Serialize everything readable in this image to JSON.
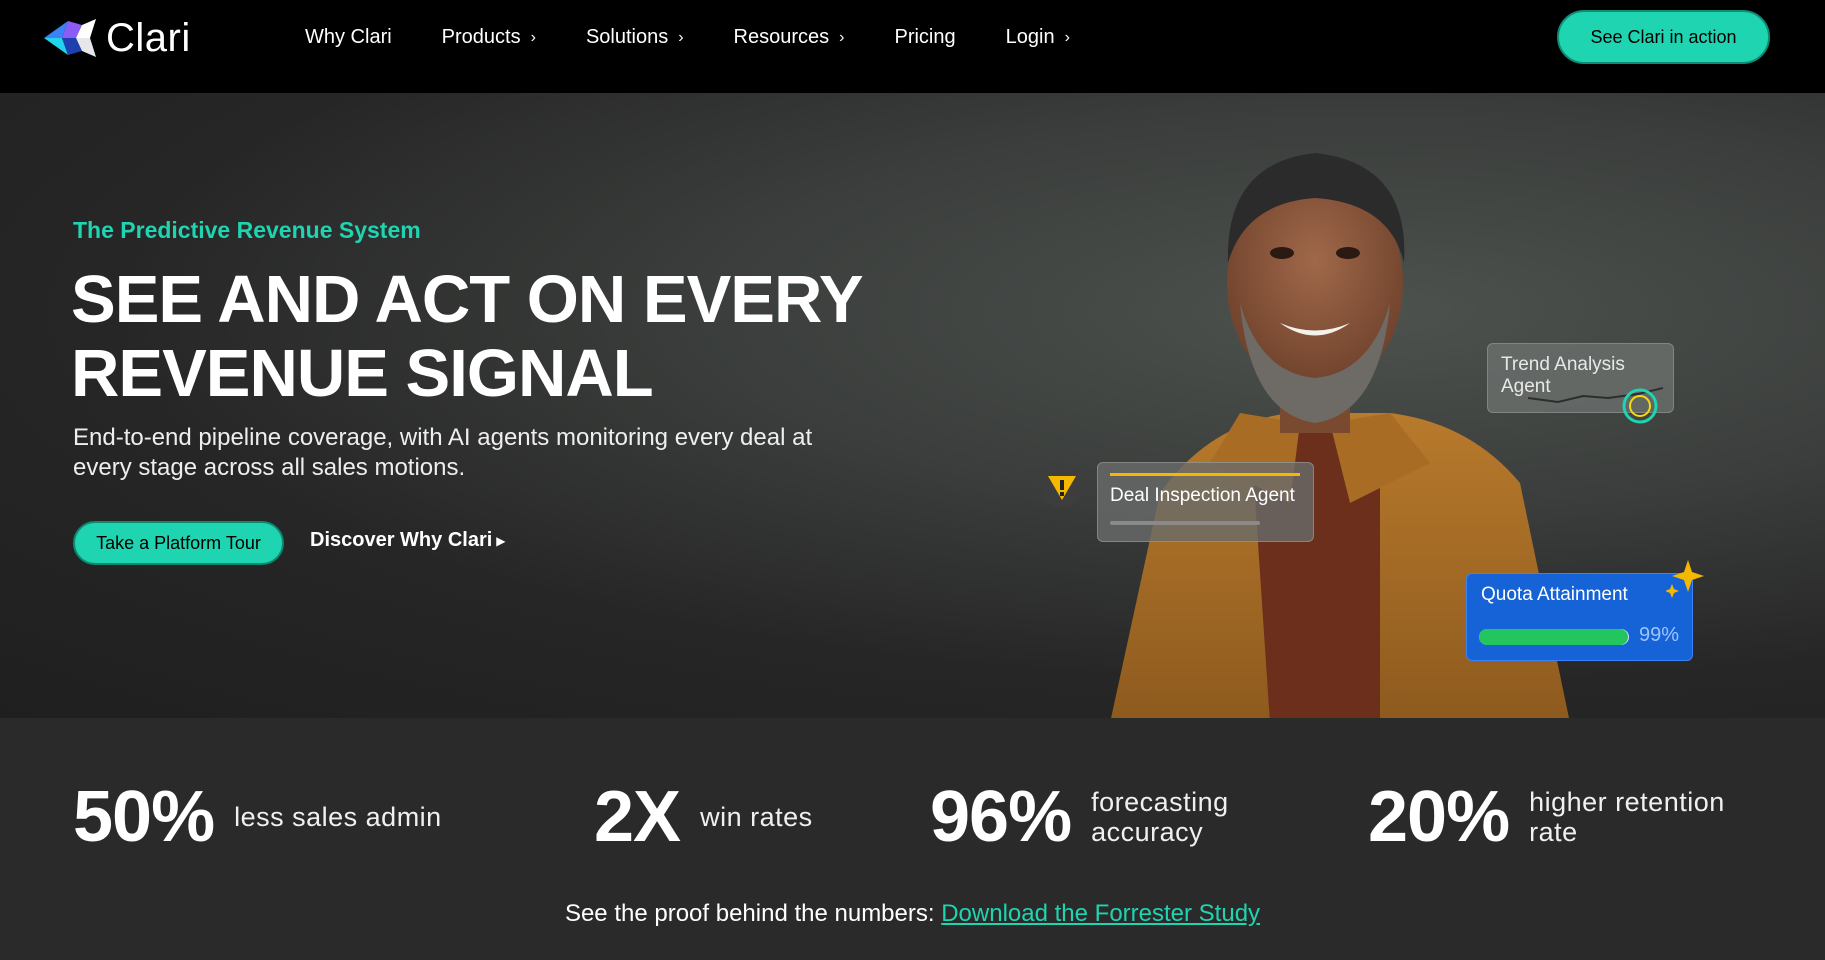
{
  "brand": {
    "name": "Clari",
    "accent": "#1fd4b0"
  },
  "nav": {
    "items": [
      {
        "label": "Why Clari",
        "has_chevron": false
      },
      {
        "label": "Products",
        "has_chevron": true
      },
      {
        "label": "Solutions",
        "has_chevron": true
      },
      {
        "label": "Resources",
        "has_chevron": true
      },
      {
        "label": "Pricing",
        "has_chevron": false
      },
      {
        "label": "Login",
        "has_chevron": true
      }
    ],
    "cta_label": "See Clari in action"
  },
  "hero": {
    "eyebrow": "The Predictive Revenue System",
    "headline_line1": "SEE AND ACT ON EVERY",
    "headline_line2": "REVENUE SIGNAL",
    "subtext": "End-to-end pipeline coverage, with AI agents monitoring every deal at every stage across all sales motions.",
    "primary_cta": "Take a Platform Tour",
    "secondary_cta": "Discover Why Clari"
  },
  "cards": {
    "trend": "Trend Analysis Agent",
    "deal": "Deal Inspection Agent",
    "quota_title": "Quota Attainment",
    "quota_value": "99%",
    "quota_fraction": 0.99
  },
  "stats": [
    {
      "value": "50%",
      "label": "less sales admin"
    },
    {
      "value": "2X",
      "label": "win rates"
    },
    {
      "value": "96%",
      "label": "forecasting accuracy"
    },
    {
      "value": "20%",
      "label": "higher retention rate"
    }
  ],
  "proof": {
    "text": "See the proof behind the numbers:",
    "link": "Download the Forrester Study"
  }
}
